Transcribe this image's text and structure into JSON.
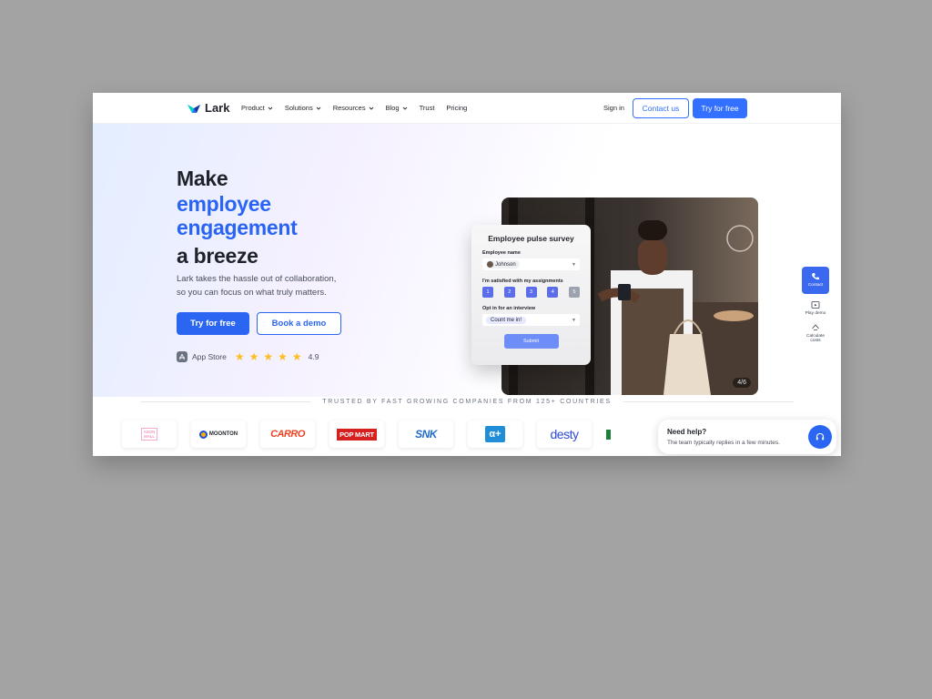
{
  "nav": {
    "logo_text": "Lark",
    "menu": [
      {
        "label": "Product",
        "has_dropdown": true
      },
      {
        "label": "Solutions",
        "has_dropdown": true
      },
      {
        "label": "Resources",
        "has_dropdown": true
      },
      {
        "label": "Blog",
        "has_dropdown": true
      },
      {
        "label": "Trust",
        "has_dropdown": false
      },
      {
        "label": "Pricing",
        "has_dropdown": false
      }
    ],
    "signin": "Sign in",
    "contact": "Contact us",
    "try": "Try for free"
  },
  "hero": {
    "line1": "Make",
    "line2": "employee",
    "line3": "engagement",
    "line4": "a breeze",
    "sub1": "Lark takes the hassle out of collaboration,",
    "sub2": "so you can focus on what truly matters.",
    "try": "Try for free",
    "demo": "Book a demo",
    "rating_label": "App Store",
    "rating_stars": 5,
    "rating_value": "4.9"
  },
  "survey": {
    "title": "Employee pulse survey",
    "name_label": "Employee name",
    "name_value": "Johnson",
    "satisfied_label": "I'm satisfied with my assignments",
    "scale": [
      "1",
      "2",
      "3",
      "4",
      "5"
    ],
    "optin_label": "Opt in for an interview",
    "optin_value": "Count me in!",
    "submit": "Submit"
  },
  "slider": {
    "counter": "4/6"
  },
  "side": {
    "contact": "Contact",
    "play": "Play demo",
    "calc1": "Calculate",
    "calc2": "costs"
  },
  "trusted": {
    "text": "TRUSTED BY FAST GROWING COMPANIES FROM 125+ COUNTRIES",
    "logos": {
      "asgn1": "ASGN",
      "asgn2": "MALL",
      "moonton": "MOONTON",
      "carro": "CARRO",
      "popmart": "POP MART",
      "snk": "SNK",
      "q": "α+",
      "desty": "desty"
    }
  },
  "help": {
    "title": "Need help?",
    "sub": "The team typically replies in a few minutes."
  },
  "colors": {
    "brand_blue": "#3370ff",
    "headline_blue": "#2a64f5",
    "background": "#a3a3a3"
  }
}
